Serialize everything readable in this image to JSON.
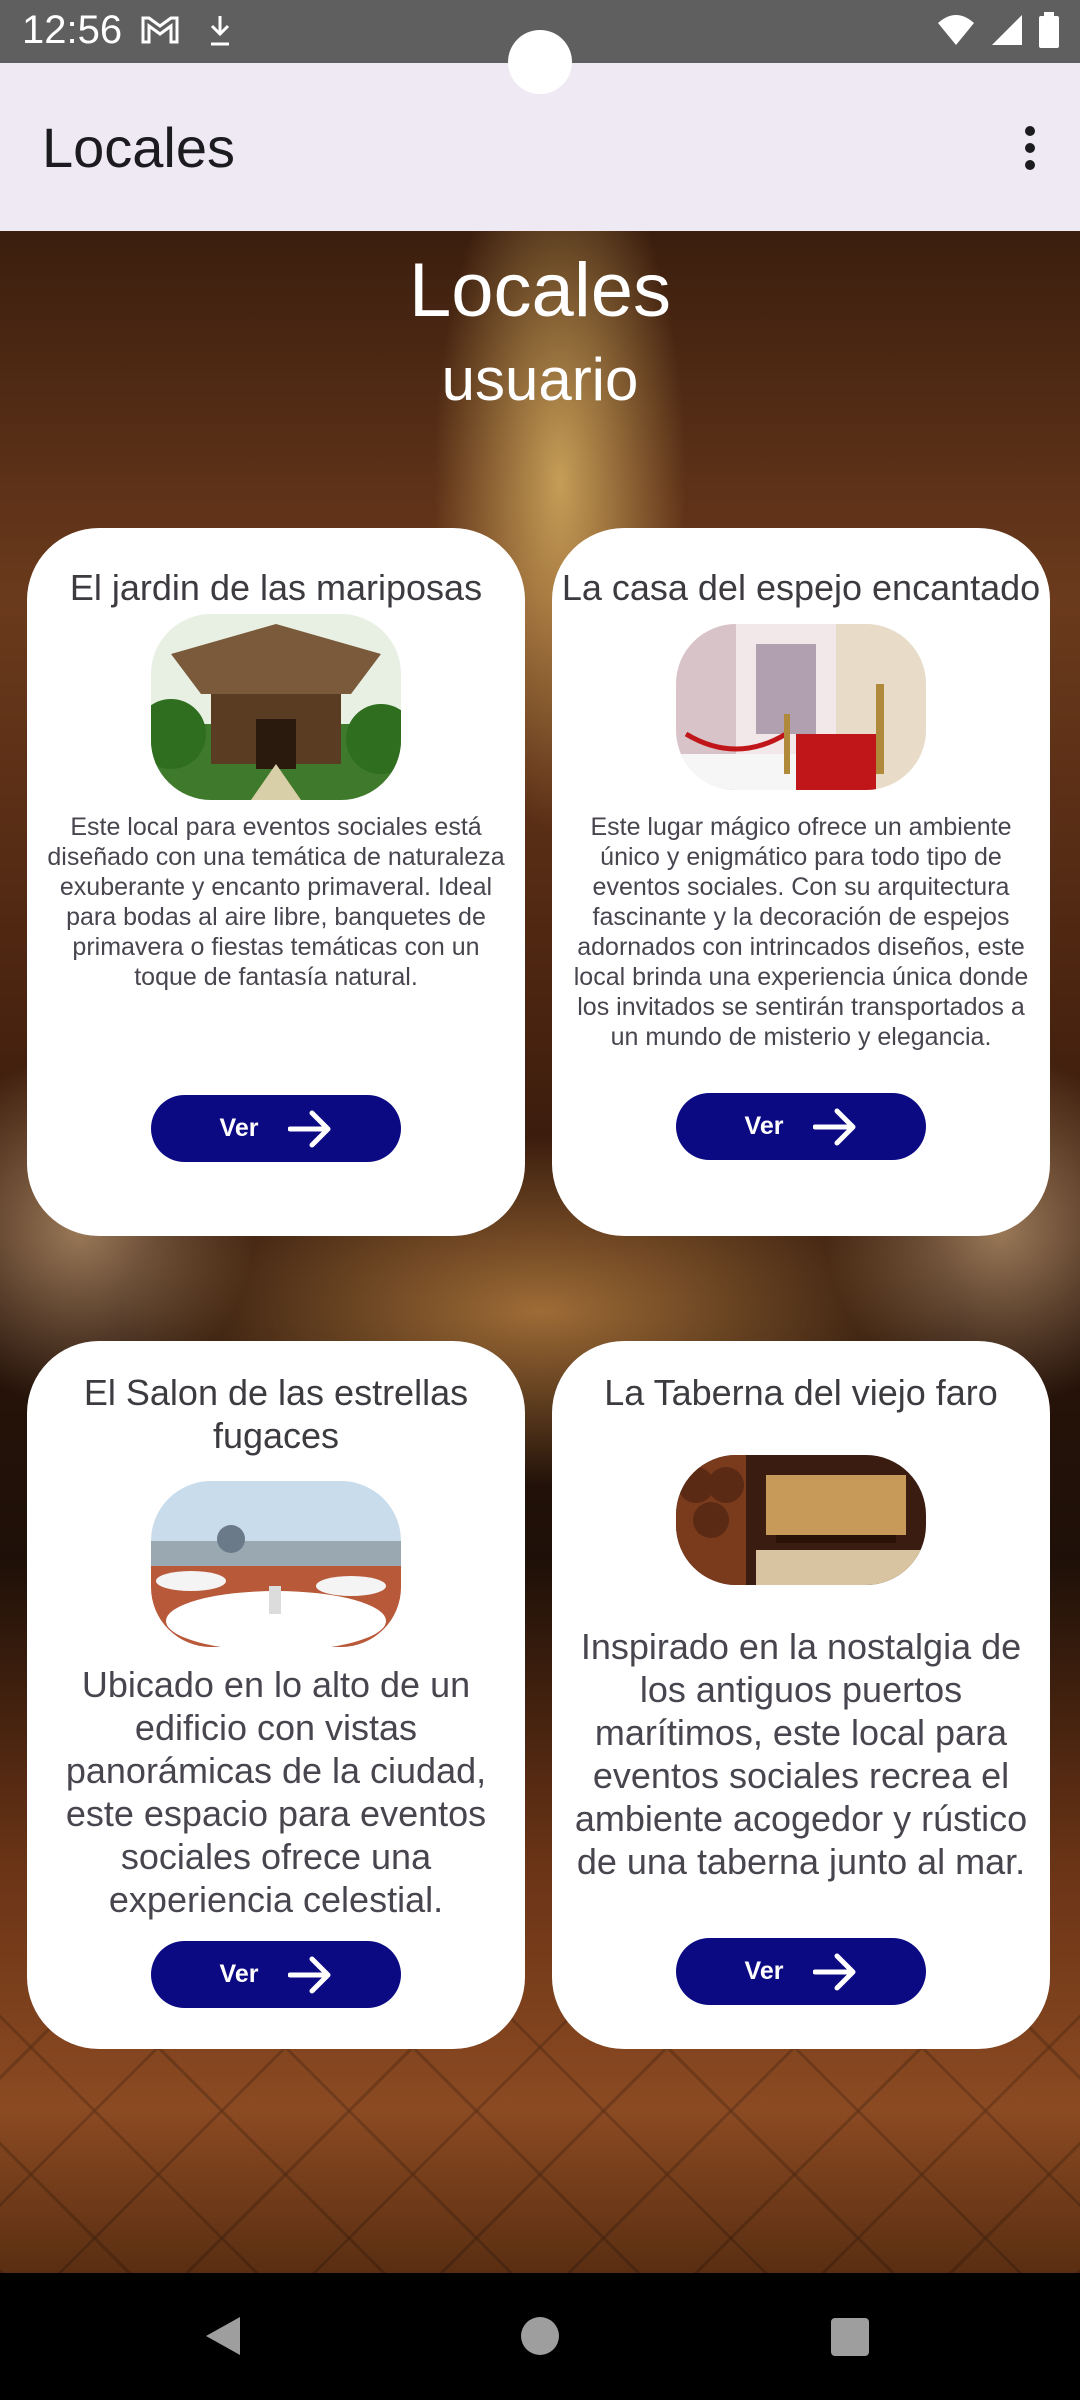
{
  "status_bar": {
    "time": "12:56",
    "icons": [
      "gmail-icon",
      "download-icon",
      "wifi-icon",
      "signal-icon",
      "battery-icon"
    ]
  },
  "app_bar": {
    "title": "Locales",
    "menu_icon": "more-vert-icon"
  },
  "header": {
    "title": "Locales",
    "subtitle": "usuario"
  },
  "cards": [
    {
      "title": "El jardin de las mariposas",
      "description": "Este local para eventos sociales está diseñado con una temática de naturaleza exuberante y encanto primaveral. Ideal para bodas al aire libre, banquetes de primavera o fiestas temáticas con un toque de fantasía natural.",
      "button_label": "Ver"
    },
    {
      "title": "La casa del espejo encantado",
      "description": "Este lugar mágico ofrece un ambiente único y enigmático para todo tipo de eventos sociales. Con su arquitectura fascinante y la decoración de espejos adornados con intrincados diseños, este local brinda una experiencia única donde los invitados se sentirán transportados a un mundo de misterio y elegancia.",
      "button_label": "Ver"
    },
    {
      "title": "El Salon de las estrellas fugaces",
      "description": "Ubicado en lo alto de un edificio con vistas panorámicas de la ciudad, este espacio para eventos sociales ofrece una experiencia celestial.",
      "button_label": "Ver"
    },
    {
      "title": "La Taberna del viejo faro",
      "description": "Inspirado en la nostalgia de los antiguos puertos marítimos, este local para eventos sociales recrea el ambiente acogedor y rústico de una taberna junto al mar.",
      "button_label": "Ver"
    }
  ],
  "colors": {
    "button": "#0b0a83",
    "app_bar": "#efe9f3",
    "status_bar": "#5f5f5f"
  },
  "nav_bar": {
    "icons": [
      "back-icon",
      "home-icon",
      "recents-icon"
    ]
  }
}
